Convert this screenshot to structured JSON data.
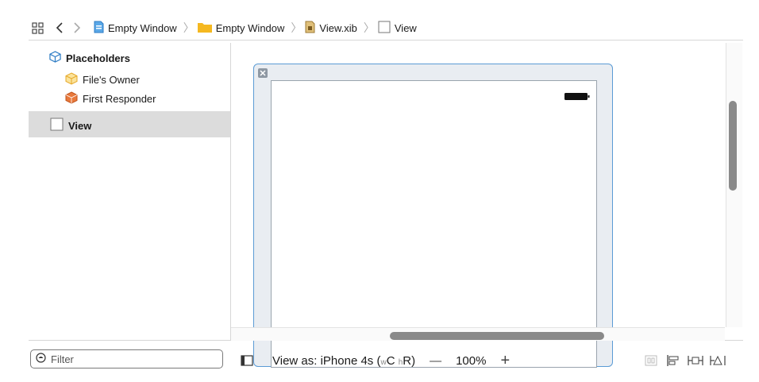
{
  "jumpbar": {
    "crumbs": [
      {
        "label": "Empty Window",
        "icon": "project-file-icon"
      },
      {
        "label": "Empty Window",
        "icon": "folder-icon"
      },
      {
        "label": "View.xib",
        "icon": "xib-file-icon"
      },
      {
        "label": "View",
        "icon": "view-icon"
      }
    ]
  },
  "outline": {
    "placeholders_label": "Placeholders",
    "files_owner_label": "File's Owner",
    "first_responder_label": "First Responder",
    "view_label": "View"
  },
  "filter": {
    "placeholder": "Filter"
  },
  "bottom": {
    "view_as_prefix": "View as: iPhone 4s (",
    "w_label": "w",
    "compact_label": "C ",
    "h_label": "h",
    "regular_label": "R)",
    "zoom_minus": "—",
    "zoom": "100%",
    "zoom_plus": "+"
  },
  "colors": {
    "selection": "#dcdcdc",
    "frame_border": "#5b9bd5",
    "folder": "#f5b820"
  }
}
